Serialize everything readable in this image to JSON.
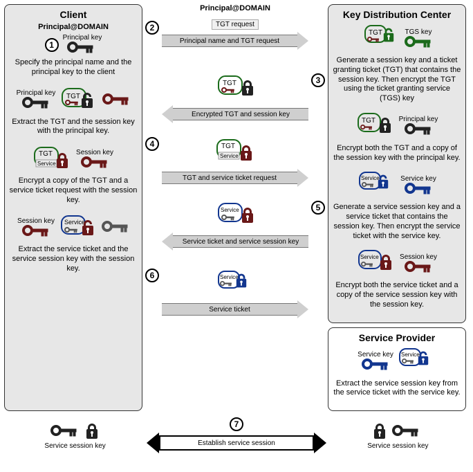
{
  "client": {
    "title": "Client",
    "subtitle": "Principal@DOMAIN",
    "step1_keylabel": "Principal key",
    "step1_desc": "Specify the principal name and the principal key to the client",
    "step3_keylabel": "Principal key",
    "step3_tgt": "TGT",
    "step3_desc": "Extract the TGT and the session key with the principal key.",
    "step4_tgt": "TGT",
    "step4_service": "Service",
    "step4_sessionkey": "Session key",
    "step4_desc": "Encrypt a copy of the TGT and a service ticket request with the session key.",
    "step5_sessionkey": "Session key",
    "step5_service": "Service",
    "step5_desc": "Extract the service ticket and the service session key with the session key.",
    "bottom_keylabel": "Service session key"
  },
  "center": {
    "subtitle": "Principal@DOMAIN",
    "step2_box": "TGT request",
    "step2_arrow": "Principal name and TGT request",
    "step3_tgt": "TGT",
    "step3_arrow": "Encrypted TGT and session key",
    "step4_tgt": "TGT",
    "step4_service": "Service",
    "step4_arrow": "TGT and service ticket request",
    "step5_service": "Service",
    "step5_arrow": "Service ticket and service session key",
    "step6_service": "Service",
    "step6_arrow": "Service ticket",
    "step7_arrow": "Establish service session"
  },
  "kdc": {
    "title": "Key Distribution Center",
    "step2_tgt": "TGT",
    "step2_tgskey": "TGS key",
    "step2_desc": "Generate a session key and a ticket granting ticket (TGT) that contains the session key. Then encrypt the TGT using the ticket granting service (TGS) key",
    "step3_tgt": "TGT",
    "step3_pkey": "Principal key",
    "step3_desc": "Encrypt both the TGT and a copy of the session key with the principal key.",
    "step4_service": "Service",
    "step4_servicekey": "Service key",
    "step4_desc": "Generate a service session key and a service ticket that contains the session key. Then encrypt the service ticket with the service key.",
    "step5_service": "Service",
    "step5_sessionkey": "Session key",
    "step5_desc": "Encrypt both the service ticket and a copy of the service session key with the session key."
  },
  "sp": {
    "title": "Service Provider",
    "servicekey": "Service key",
    "service": "Service",
    "desc": "Extract the service session key from the service ticket with the service key.",
    "bottom_keylabel": "Service session key"
  },
  "nums": {
    "n1": "1",
    "n2": "2",
    "n3": "3",
    "n4": "4",
    "n5": "5",
    "n6": "6",
    "n7": "7"
  }
}
